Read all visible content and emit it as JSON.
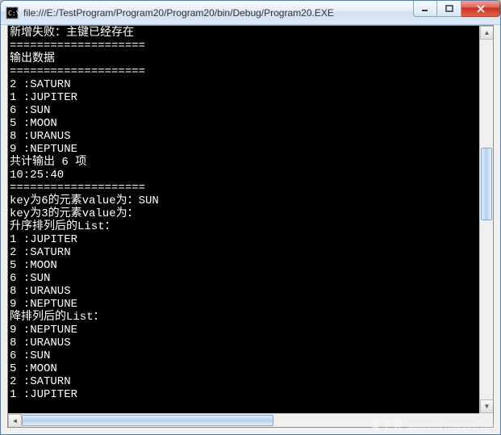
{
  "window": {
    "title": "file:///E:/TestProgram/Program20/Program20/bin/Debug/Program20.EXE"
  },
  "console": {
    "lines": [
      "新增失败：主键已经存在",
      "====================",
      "输出数据",
      "====================",
      "2       :SATURN",
      "1       :JUPITER",
      "6       :SUN",
      "5       :MOON",
      "8       :URANUS",
      "9       :NEPTUNE",
      "共计输出 6 项",
      "10:25:40",
      "====================",
      "key为6的元素value为：SUN",
      "key为3的元素value为：",
      "升序排列后的List：",
      "1       :JUPITER",
      "2       :SATURN",
      "5       :MOON",
      "6       :SUN",
      "8       :URANUS",
      "9       :NEPTUNE",
      "降排列后的List：",
      "9       :NEPTUNE",
      "8       :URANUS",
      "6       :SUN",
      "5       :MOON",
      "2       :SATURN",
      "1       :JUPITER"
    ]
  },
  "watermark": {
    "main": "查字典",
    "sub": "jiaocheng.chazidian.com"
  }
}
